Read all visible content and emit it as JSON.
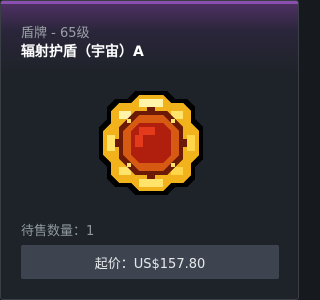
{
  "item": {
    "type_label": "盾牌 - 65级",
    "name": "辐射护盾（宇宙）A"
  },
  "listing": {
    "quantity_label": "待售数量：",
    "quantity": "1",
    "price_button": "起价：US$157.80"
  },
  "icon": "cosmic-radiation-shield-pixel-icon",
  "colors": {
    "rarity_accent": "#8b4fb0",
    "card_bg": "#1e2329",
    "button_bg": "#3d4450"
  }
}
